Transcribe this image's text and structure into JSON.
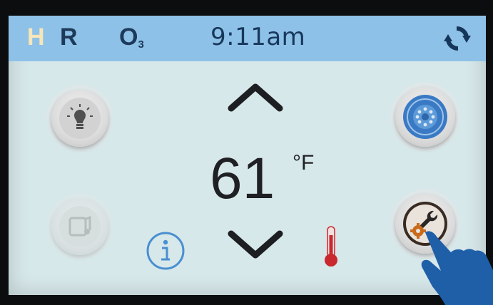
{
  "status": {
    "heater": "H",
    "recirc": "R",
    "ozone_main": "O",
    "ozone_sub": "3",
    "time": "9:11am"
  },
  "temperature": {
    "value": "61",
    "unit": "°F"
  },
  "colors": {
    "screen_bg": "#d7e8ea",
    "status_bar": "#8ec1e8",
    "heater_letter": "#f6e6b9",
    "status_text": "#1d3a5b",
    "jets_blue": "#3a7ac4",
    "info_blue": "#4a8fd0",
    "thermometer_red": "#c9282e",
    "hand_blue": "#1f5fa8"
  },
  "icons": {
    "refresh": "refresh-icon",
    "light": "light-bulb-icon",
    "music": "music-note-icon",
    "jets": "jets-icon",
    "settings": "settings-wrench-gear-icon",
    "up": "chevron-up-icon",
    "down": "chevron-down-icon",
    "info": "info-icon",
    "thermometer": "thermometer-icon",
    "pointer": "pointing-hand-icon"
  }
}
